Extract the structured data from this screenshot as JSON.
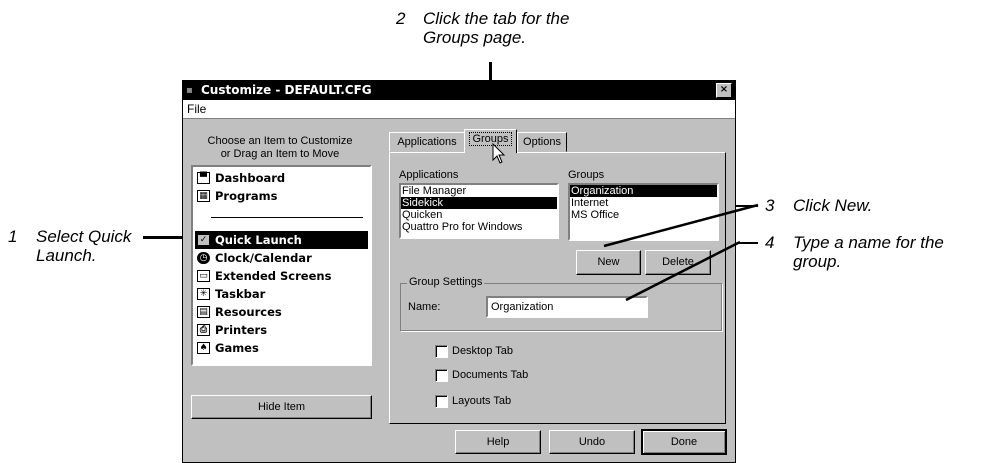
{
  "callouts": {
    "step2": {
      "num": "2",
      "line1": "Click the tab for the",
      "line2": "Groups page."
    },
    "step1": {
      "num": "1",
      "line1": "Select Quick",
      "line2": "Launch."
    },
    "step3": {
      "num": "3",
      "line1": "Click New."
    },
    "step4": {
      "num": "4",
      "line1": "Type a name for the",
      "line2": "group."
    }
  },
  "window": {
    "title": "Customize - DEFAULT.CFG",
    "close": "×"
  },
  "menu": {
    "file": "File"
  },
  "left": {
    "instructions_line1": "Choose an Item to Customize",
    "instructions_line2": "or Drag an Item to Move",
    "items": [
      {
        "label": "Dashboard",
        "icon": "dashboard-icon"
      },
      {
        "label": "Programs",
        "icon": "programs-icon"
      },
      {
        "label": "Quick Launch",
        "icon": "quick-launch-icon"
      },
      {
        "label": "Clock/Calendar",
        "icon": "clock-icon"
      },
      {
        "label": "Extended Screens",
        "icon": "extended-screens-icon"
      },
      {
        "label": "Taskbar",
        "icon": "taskbar-icon"
      },
      {
        "label": "Resources",
        "icon": "resources-icon"
      },
      {
        "label": "Printers",
        "icon": "printers-icon"
      },
      {
        "label": "Games",
        "icon": "games-icon"
      }
    ],
    "selected": "Quick Launch",
    "hide_button": "Hide Item"
  },
  "tabs": [
    {
      "label": "Applications"
    },
    {
      "label": "Groups"
    },
    {
      "label": "Options"
    }
  ],
  "active_tab": "Groups",
  "groups_page": {
    "applications_label": "Applications",
    "applications": [
      "File Manager",
      "Sidekick",
      "Quicken",
      "Quattro Pro for Windows"
    ],
    "applications_selected": "Sidekick",
    "groups_label": "Groups",
    "groups": [
      "Organization",
      "Internet",
      "MS Office"
    ],
    "groups_selected": "Organization",
    "new_button": "New",
    "delete_button": "Delete",
    "group_settings_label": "Group Settings",
    "name_label": "Name:",
    "name_value": "Organization",
    "checkboxes": [
      {
        "label": "Desktop Tab",
        "checked": false
      },
      {
        "label": "Documents Tab",
        "checked": false
      },
      {
        "label": "Layouts Tab",
        "checked": false
      }
    ]
  },
  "footer": {
    "help": "Help",
    "undo": "Undo",
    "done": "Done"
  }
}
